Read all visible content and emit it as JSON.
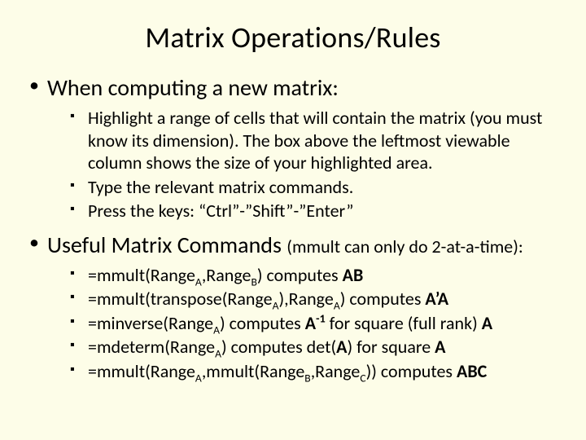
{
  "title": "Matrix Operations/Rules",
  "section1": {
    "heading": "When computing a new matrix:",
    "items": [
      "Highlight a range of cells that will contain the matrix (you must know its dimension).  The box above the leftmost viewable column shows the size of your highlighted area.",
      "Type the relevant matrix commands.",
      "Press the keys: “Ctrl”-”Shift”-”Enter”"
    ]
  },
  "section2": {
    "heading": "Useful Matrix Commands",
    "paren": "(mmult can only do 2-at-a-time):",
    "items": [
      {
        "pre": "=mmult(Range",
        "subA": "A",
        "mid1": ",Range",
        "subB": "B",
        "post1": ") computes ",
        "bold1": "AB"
      },
      {
        "pre": "=mmult(transpose(Range",
        "subA": "A",
        "mid1": "),Range",
        "subB": "A",
        "post1": ") computes ",
        "bold1": "A’A"
      },
      {
        "pre": "=minverse(Range",
        "subA": "A",
        "post1": ") computes ",
        "bold1": "A",
        "sup1": "-1",
        "tail": " for square (full rank) ",
        "bold2": "A"
      },
      {
        "pre": "=mdeterm(Range",
        "subA": "A",
        "post1": ") computes det(",
        "bold1": "A",
        "tail": ") for square ",
        "bold2": "A"
      },
      {
        "pre": "=mmult(Range",
        "subA": "A",
        "mid1": ",mmult(Range",
        "subB": "B",
        "mid2": ",Range",
        "subC": "C",
        "post1": ")) computes ",
        "bold1": "ABC"
      }
    ]
  }
}
